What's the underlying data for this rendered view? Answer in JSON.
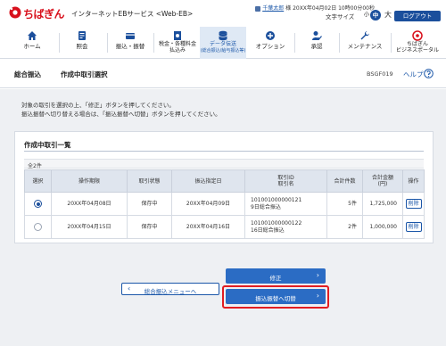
{
  "header": {
    "logo_text": "ちばぎん",
    "service_name": "インターネットEBサービス <Web-EB>",
    "user_name": "千葉太郎",
    "user_suffix": "様",
    "last_login": "20XX年04月02日 10時00分00秒",
    "font_size_label": "文字サイズ",
    "font_small": "小",
    "font_mid": "中",
    "font_large": "大",
    "logout_label": "ログアウト",
    "brand_color": "#d8101c",
    "accent_color": "#1b4f9c"
  },
  "nav": [
    {
      "label": "ホーム",
      "icon": "home-icon"
    },
    {
      "label": "照会",
      "icon": "inquiry-icon"
    },
    {
      "label": "振込・振替",
      "icon": "transfer-icon"
    },
    {
      "label": "税金・各種料金",
      "label2": "払込み",
      "icon": "tax-payment-icon"
    },
    {
      "label": "データ伝送",
      "label2": "(総合振込/給与振込等)",
      "icon": "data-transmission-icon",
      "active": true
    },
    {
      "label": "オプション",
      "icon": "option-icon"
    },
    {
      "label": "承認",
      "icon": "approval-icon"
    },
    {
      "label": "メンテナンス",
      "icon": "maintenance-icon"
    },
    {
      "label": "ちばぎん",
      "label2": "ビジネスポータル",
      "icon": "business-portal-icon"
    }
  ],
  "title": {
    "crumb1": "総合振込",
    "crumb2": "作成中取引選択",
    "screen_id": "BSGF019",
    "help_label": "ヘルプ"
  },
  "instructions": [
    "対象の取引を選択の上、「修正」ボタンを押してください。",
    "振込振替へ切り替える場合は、「振込振替へ切替」ボタンを押してください。"
  ],
  "panel": {
    "title": "作成中取引一覧",
    "count": "全2件",
    "headers": [
      "選択",
      "操作期限",
      "取引状態",
      "振込指定日",
      "取引ID",
      "取引名",
      "合計件数",
      "合計金額",
      "(円)",
      "操作"
    ],
    "rows": [
      {
        "selected": true,
        "deadline": "20XX年04月08日",
        "status": "保存中",
        "date": "20XX年04月09日",
        "id": "101001000000121",
        "name": "9日総合振込",
        "count": "5件",
        "amount": "1,725,000",
        "action": "削除"
      },
      {
        "selected": false,
        "deadline": "20XX年04月15日",
        "status": "保存中",
        "date": "20XX年04月16日",
        "id": "101001000000122",
        "name": "16日総合振込",
        "count": "2件",
        "amount": "1,000,000",
        "action": "削除"
      }
    ]
  },
  "buttons": {
    "back": "総合振込メニューへ",
    "fix": "修正",
    "switch": "振込振替へ切替"
  }
}
